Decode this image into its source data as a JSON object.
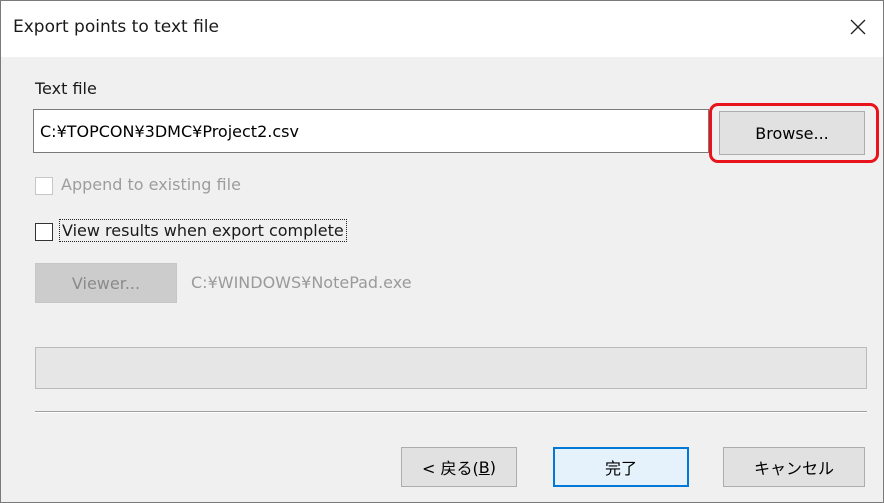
{
  "window": {
    "title": "Export points to text file",
    "close_icon": "close-icon"
  },
  "text_file": {
    "label": "Text file",
    "value": "C:¥TOPCON¥3DMC¥Project2.csv",
    "browse_label": "Browse...",
    "highlight_color": "#e8131b"
  },
  "options": {
    "append_label": "Append to existing file",
    "append_checked": false,
    "append_enabled": false,
    "view_results_label": "View results when export complete",
    "view_results_checked": false
  },
  "viewer": {
    "button_label": "Viewer...",
    "path": "C:¥WINDOWS¥NotePad.exe"
  },
  "progress": {
    "value": 0
  },
  "footer": {
    "back_prefix": "< 戻る(",
    "back_key": "B",
    "back_suffix": ")",
    "finish_label": "完了",
    "cancel_label": "キャンセル"
  }
}
